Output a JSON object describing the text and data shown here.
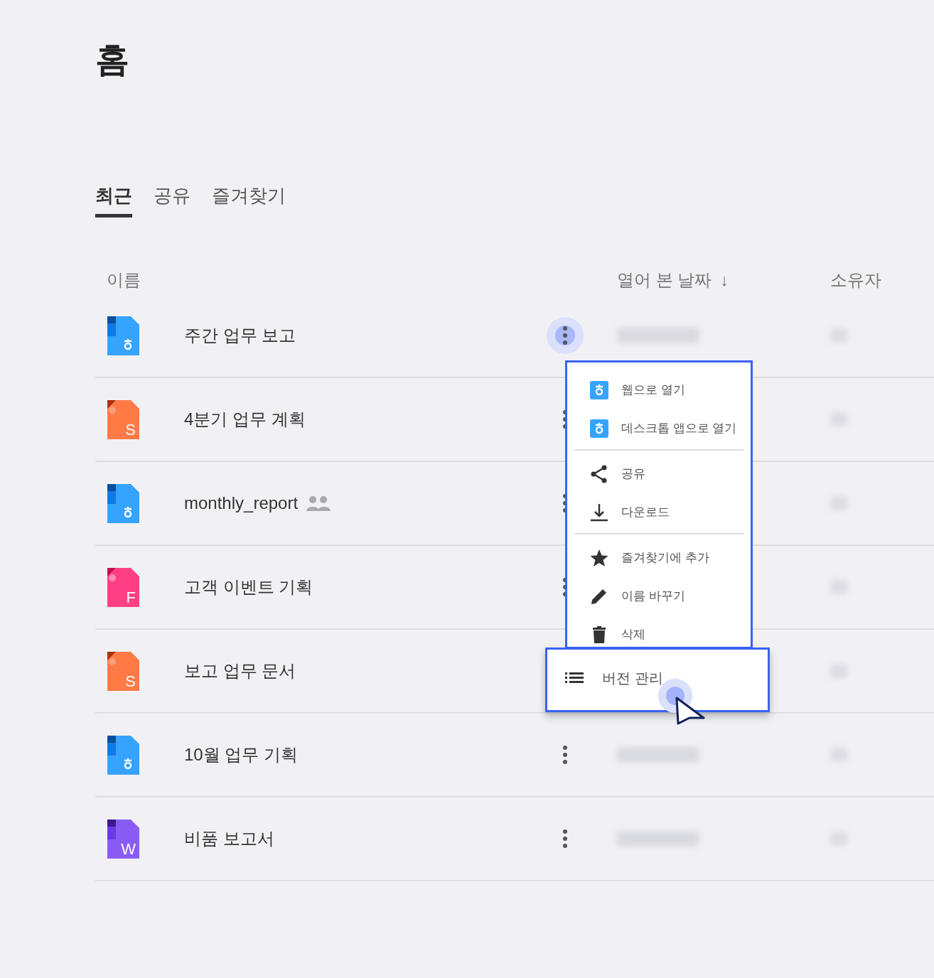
{
  "page": {
    "title": "홈"
  },
  "tabs": [
    {
      "label": "최근",
      "selected": true
    },
    {
      "label": "공유",
      "selected": false
    },
    {
      "label": "즐겨찾기",
      "selected": false
    }
  ],
  "table": {
    "columns": [
      "이름",
      "열어 본 날짜",
      "소유자"
    ],
    "sort_icon": "↓",
    "rows": [
      {
        "name": "주간 업무 보고",
        "kind": "doc",
        "shared": false,
        "menu_open": true
      },
      {
        "name": "4분기 업무 계획",
        "kind": "sheet",
        "badge": "S",
        "shared": false,
        "menu_open": false
      },
      {
        "name": "monthly_report",
        "kind": "doc",
        "shared": true,
        "menu_open": false
      },
      {
        "name": "고객 이벤트 기획",
        "kind": "form",
        "badge": "F",
        "shared": false,
        "menu_open": false
      },
      {
        "name": "보고 업무 문서",
        "kind": "sheet",
        "badge": "S",
        "shared": false,
        "menu_open": false
      },
      {
        "name": "10월 업무 기획",
        "kind": "doc",
        "shared": false,
        "menu_open": false
      },
      {
        "name": "비품 보고서",
        "kind": "word",
        "badge": "W",
        "shared": false,
        "menu_open": false
      }
    ]
  },
  "context_menu": {
    "groups": [
      [
        {
          "label": "웹으로 열기",
          "kind": "app",
          "highlighted": false
        },
        {
          "label": "데스크톱 앱으로 열기",
          "kind": "app",
          "highlighted": false
        }
      ],
      [
        {
          "label": "공유",
          "kind": "share",
          "highlighted": false
        },
        {
          "label": "다운로드",
          "kind": "download",
          "highlighted": false
        }
      ],
      [
        {
          "label": "즐겨찾기에 추가",
          "kind": "star",
          "highlighted": false
        },
        {
          "label": "이름 바꾸기",
          "kind": "rename",
          "highlighted": false
        },
        {
          "label": "삭제",
          "kind": "delete",
          "highlighted": false
        },
        {
          "label": "버전 관리",
          "kind": "versions",
          "highlighted": true
        }
      ]
    ]
  }
}
